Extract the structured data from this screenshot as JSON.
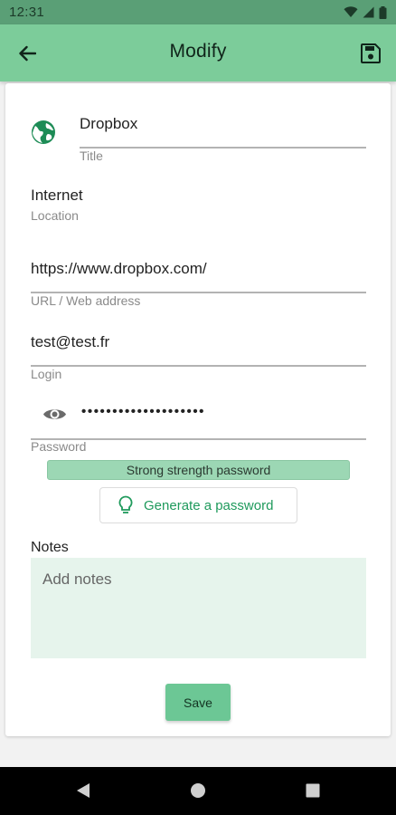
{
  "status_bar": {
    "time": "12:31"
  },
  "app_bar": {
    "title": "Modify"
  },
  "form": {
    "title_value": "Dropbox",
    "title_label": "Title",
    "location_value": "Internet",
    "location_label": "Location",
    "url_value": "https://www.dropbox.com/",
    "url_label": "URL / Web address",
    "login_value": "test@test.fr",
    "login_label": "Login",
    "password_mask": "••••••••••••••••••••",
    "password_label": "Password",
    "strength_text": "Strong strength password",
    "generate_label": "Generate a password",
    "notes_label": "Notes",
    "notes_placeholder": "Add notes",
    "save_label": "Save"
  },
  "colors": {
    "status_bar": "#5a9f76",
    "app_bar": "#7ccc9a",
    "accent": "#1f9a5c",
    "strength": "#9cd7b4",
    "notes_bg": "#e6f4ec",
    "save_button": "#6cc795"
  },
  "icons": {
    "back": "arrow-left-icon",
    "save": "floppy-disk-icon",
    "globe": "globe-icon",
    "eye": "eye-icon",
    "bulb": "lightbulb-icon"
  }
}
